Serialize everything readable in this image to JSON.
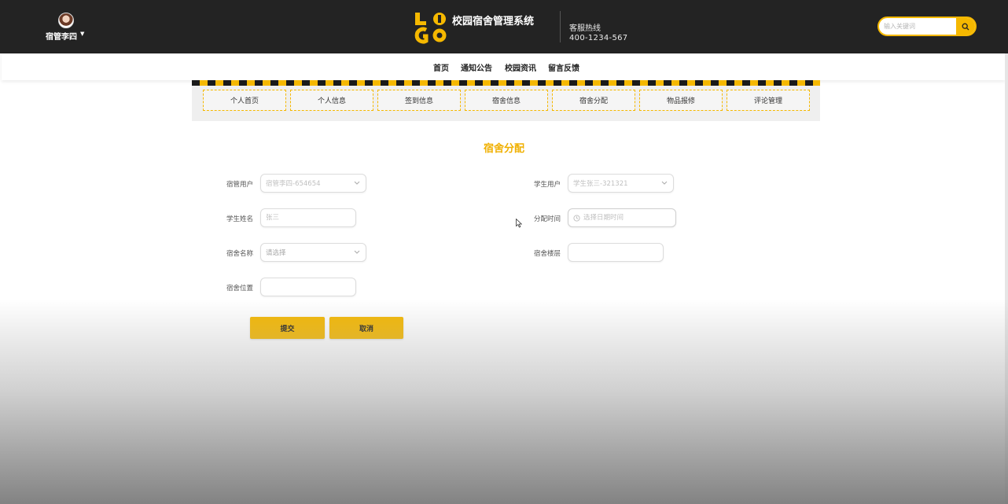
{
  "header": {
    "username": "宿管李四",
    "site_title": "校园宿舍管理系统",
    "logo_letters": "LOGO",
    "hotline_label": "客服热线",
    "hotline_number": "400-1234-567",
    "search_placeholder": "输入关键词",
    "accent_color": "#f5b800",
    "bg_color": "#232323"
  },
  "nav": {
    "items": [
      {
        "label": "首页"
      },
      {
        "label": "通知公告"
      },
      {
        "label": "校园资讯"
      },
      {
        "label": "留言反馈"
      }
    ]
  },
  "tabs": [
    {
      "label": "个人首页"
    },
    {
      "label": "个人信息"
    },
    {
      "label": "签到信息"
    },
    {
      "label": "宿舍信息"
    },
    {
      "label": "宿舍分配"
    },
    {
      "label": "物品报修"
    },
    {
      "label": "评论管理"
    }
  ],
  "form": {
    "title": "宿舍分配",
    "fields": {
      "manager_user": {
        "label": "宿管用户",
        "value": "宿管李四-654654"
      },
      "student_user": {
        "label": "学生用户",
        "value": "学生张三-321321"
      },
      "student_name": {
        "label": "学生姓名",
        "placeholder": "张三"
      },
      "assign_time": {
        "label": "分配时间",
        "placeholder": "选择日期时间"
      },
      "dorm_name": {
        "label": "宿舍名称",
        "placeholder": "请选择"
      },
      "dorm_floor": {
        "label": "宿舍楼层",
        "placeholder": ""
      },
      "dorm_location": {
        "label": "宿舍位置",
        "placeholder": ""
      }
    },
    "submit_label": "提交",
    "cancel_label": "取消"
  }
}
